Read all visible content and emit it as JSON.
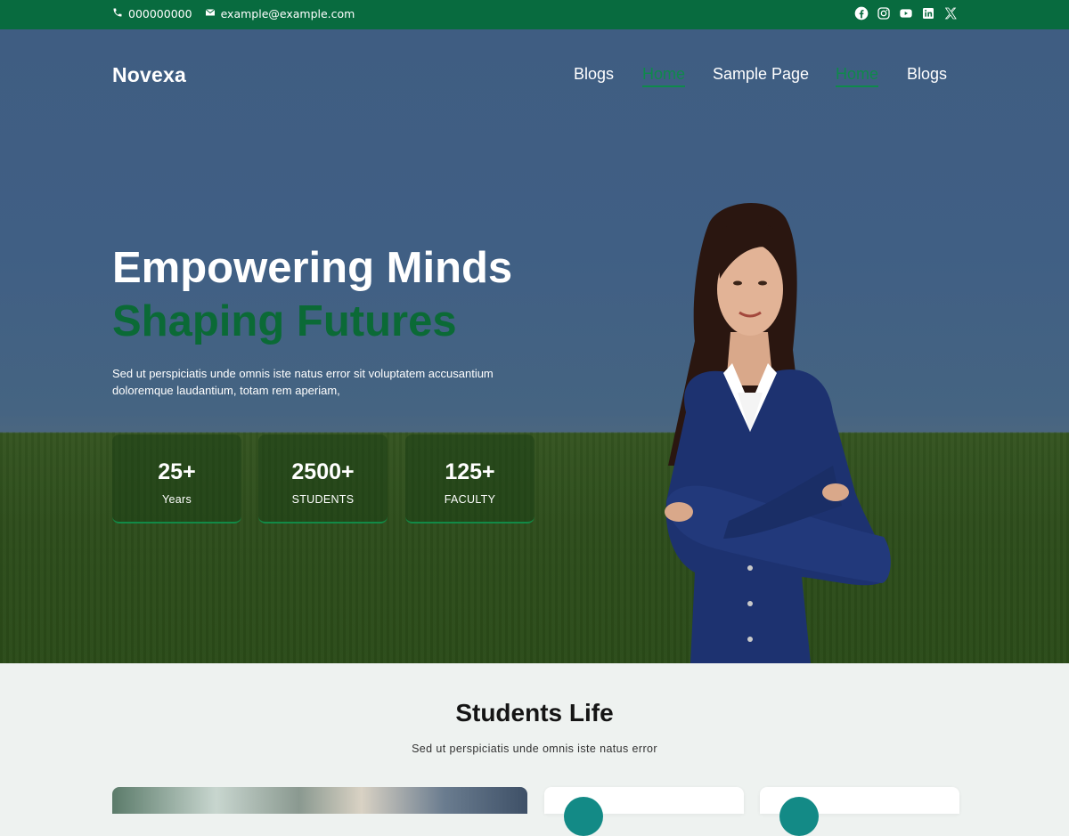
{
  "topbar": {
    "phone": "000000000",
    "email": "example@example.com",
    "social": [
      "facebook-icon",
      "instagram-icon",
      "youtube-icon",
      "linkedin-icon",
      "x-icon"
    ]
  },
  "header": {
    "logo": "Novexa",
    "nav": [
      {
        "label": "Blogs",
        "active": false
      },
      {
        "label": "Home",
        "active": true
      },
      {
        "label": "Sample Page",
        "active": false
      },
      {
        "label": "Home",
        "active": true
      },
      {
        "label": "Blogs",
        "active": false
      }
    ]
  },
  "hero": {
    "title_line1": "Empowering Minds",
    "title_line2": "Shaping Futures",
    "description": "Sed ut perspiciatis unde omnis iste natus error sit voluptatem accusantium doloremque laudantium, totam rem aperiam,",
    "stats": [
      {
        "value": "25+",
        "label": "Years"
      },
      {
        "value": "2500+",
        "label": "STUDENTS"
      },
      {
        "value": "125+",
        "label": "FACULTY"
      }
    ]
  },
  "students_section": {
    "title": "Students Life",
    "subtitle": "Sed ut perspiciatis unde omnis iste natus error"
  },
  "colors": {
    "brand_green": "#086b3f",
    "accent_green": "#0f8a4b",
    "sky_blue": "#3f5d82",
    "field_green": "#30511c",
    "section_bg": "#eef2f0"
  }
}
